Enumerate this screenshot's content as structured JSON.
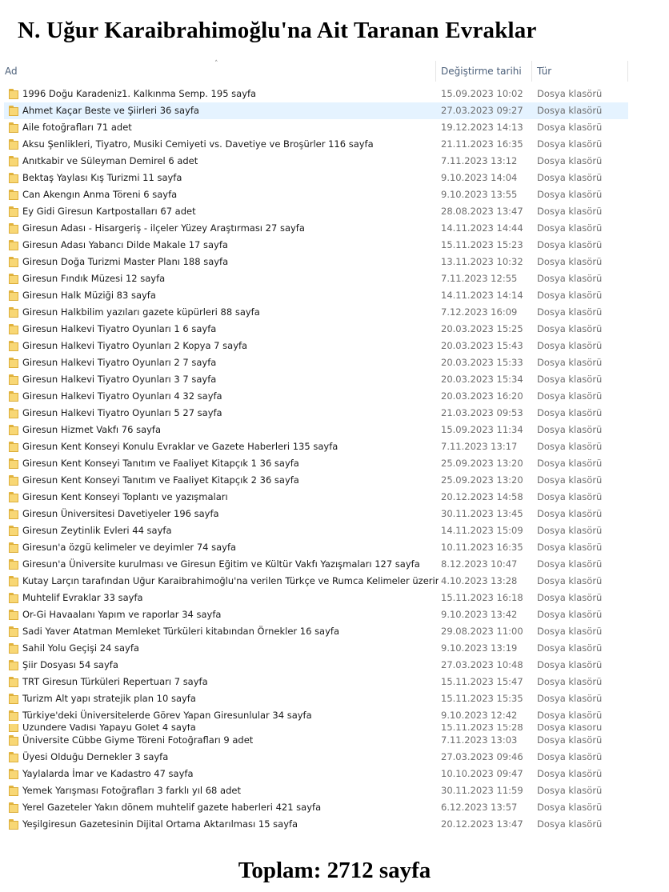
{
  "title": "N. Uğur Karaibrahimoğlu'na Ait Taranan Evraklar",
  "columns": {
    "name": "Ad",
    "date": "Değiştirme tarihi",
    "type": "Tür"
  },
  "rows": [
    {
      "name": "1996 Doğu Karadeniz1. Kalkınma Semp. 195 sayfa",
      "date": "15.09.2023 10:02",
      "type": "Dosya klasörü"
    },
    {
      "name": "Ahmet Kaçar Beste ve Şiirleri 36 sayfa",
      "date": "27.03.2023 09:27",
      "type": "Dosya klasörü",
      "selected": true
    },
    {
      "name": "Aile fotoğrafları 71 adet",
      "date": "19.12.2023 14:13",
      "type": "Dosya klasörü"
    },
    {
      "name": "Aksu Şenlikleri, Tiyatro, Musiki Cemiyeti vs. Davetiye ve Broşürler 116 sayfa",
      "date": "21.11.2023 16:35",
      "type": "Dosya klasörü"
    },
    {
      "name": "Anıtkabir ve Süleyman Demirel 6 adet",
      "date": "7.11.2023 13:12",
      "type": "Dosya klasörü"
    },
    {
      "name": "Bektaş Yaylası Kış Turizmi 11 sayfa",
      "date": "9.10.2023 14:04",
      "type": "Dosya klasörü"
    },
    {
      "name": "Can Akengın Anma Töreni 6 sayfa",
      "date": "9.10.2023 13:55",
      "type": "Dosya klasörü"
    },
    {
      "name": "Ey Gidi Giresun Kartpostalları 67 adet",
      "date": "28.08.2023 13:47",
      "type": "Dosya klasörü"
    },
    {
      "name": "Giresun Adası - Hisargeriş - ilçeler Yüzey Araştırması 27 sayfa",
      "date": "14.11.2023 14:44",
      "type": "Dosya klasörü"
    },
    {
      "name": "Giresun Adası Yabancı Dilde Makale 17 sayfa",
      "date": "15.11.2023 15:23",
      "type": "Dosya klasörü"
    },
    {
      "name": "Giresun Doğa Turizmi Master Planı 188 sayfa",
      "date": "13.11.2023 10:32",
      "type": "Dosya klasörü"
    },
    {
      "name": "Giresun Fındık Müzesi 12 sayfa",
      "date": "7.11.2023 12:55",
      "type": "Dosya klasörü"
    },
    {
      "name": "Giresun Halk Müziği 83 sayfa",
      "date": "14.11.2023 14:14",
      "type": "Dosya klasörü"
    },
    {
      "name": "Giresun Halkbilim yazıları gazete küpürleri 88 sayfa",
      "date": "7.12.2023 16:09",
      "type": "Dosya klasörü"
    },
    {
      "name": "Giresun Halkevi Tiyatro Oyunları 1 6 sayfa",
      "date": "20.03.2023 15:25",
      "type": "Dosya klasörü"
    },
    {
      "name": "Giresun Halkevi Tiyatro Oyunları 2  Kopya 7 sayfa",
      "date": "20.03.2023 15:43",
      "type": "Dosya klasörü"
    },
    {
      "name": "Giresun Halkevi Tiyatro Oyunları 2 7 sayfa",
      "date": "20.03.2023 15:33",
      "type": "Dosya klasörü"
    },
    {
      "name": "Giresun Halkevi Tiyatro Oyunları 3 7 sayfa",
      "date": "20.03.2023 15:34",
      "type": "Dosya klasörü"
    },
    {
      "name": "Giresun Halkevi Tiyatro Oyunları 4 32 sayfa",
      "date": "20.03.2023 16:20",
      "type": "Dosya klasörü"
    },
    {
      "name": "Giresun Halkevi Tiyatro Oyunları 5 27 sayfa",
      "date": "21.03.2023 09:53",
      "type": "Dosya klasörü"
    },
    {
      "name": "Giresun Hizmet Vakfı 76 sayfa",
      "date": "15.09.2023 11:34",
      "type": "Dosya klasörü"
    },
    {
      "name": "Giresun Kent Konseyi Konulu Evraklar ve Gazete Haberleri 135 sayfa",
      "date": "7.11.2023 13:17",
      "type": "Dosya klasörü"
    },
    {
      "name": "Giresun Kent Konseyi Tanıtım ve Faaliyet Kitapçık 1 36 sayfa",
      "date": "25.09.2023 13:20",
      "type": "Dosya klasörü"
    },
    {
      "name": "Giresun Kent Konseyi Tanıtım ve Faaliyet Kitapçık 2 36 sayfa",
      "date": "25.09.2023 13:20",
      "type": "Dosya klasörü"
    },
    {
      "name": "Giresun Kent Konseyi Toplantı ve yazışmaları",
      "date": "20.12.2023 14:58",
      "type": "Dosya klasörü"
    },
    {
      "name": "Giresun Üniversitesi Davetiyeler 196 sayfa",
      "date": "30.11.2023 13:45",
      "type": "Dosya klasörü"
    },
    {
      "name": "Giresun Zeytinlik Evleri 44 sayfa",
      "date": "14.11.2023 15:09",
      "type": "Dosya klasörü"
    },
    {
      "name": "Giresun'a özgü kelimeler ve deyimler 74 sayfa",
      "date": "10.11.2023 16:35",
      "type": "Dosya klasörü"
    },
    {
      "name": "Giresun'a Üniversite kurulması ve Giresun Eğitim ve Kültür Vakfı Yazışmaları 127 sayfa",
      "date": "8.12.2023 10:47",
      "type": "Dosya klasörü"
    },
    {
      "name": "Kutay Larçın tarafından Uğur Karaibrahimoğlu'na verilen Türkçe ve Rumca Kelimeler üzerine Ça...",
      "date": "4.10.2023 13:28",
      "type": "Dosya klasörü"
    },
    {
      "name": "Muhtelif Evraklar 33 sayfa",
      "date": "15.11.2023 16:18",
      "type": "Dosya klasörü"
    },
    {
      "name": "Or-Gi Havaalanı Yapım ve raporlar 34 sayfa",
      "date": "9.10.2023 13:42",
      "type": "Dosya klasörü"
    },
    {
      "name": "Sadi Yaver Atatman Memleket Türküleri kitabından Örnekler 16 sayfa",
      "date": "29.08.2023 11:00",
      "type": "Dosya klasörü"
    },
    {
      "name": "Sahil Yolu Geçişi 24 sayfa",
      "date": "9.10.2023 13:19",
      "type": "Dosya klasörü"
    },
    {
      "name": "Şiir Dosyası 54 sayfa",
      "date": "27.03.2023 10:48",
      "type": "Dosya klasörü"
    },
    {
      "name": "TRT Giresun Türküleri Repertuarı 7 sayfa",
      "date": "15.11.2023 15:47",
      "type": "Dosya klasörü"
    },
    {
      "name": "Turizm Alt yapı stratejik plan 10 sayfa",
      "date": "15.11.2023 15:35",
      "type": "Dosya klasörü"
    },
    {
      "name": "Türkiye'deki Üniversitelerde Görev Yapan Giresunlular 34 sayfa",
      "date": "9.10.2023 12:42",
      "type": "Dosya klasörü"
    },
    {
      "name": "Üzündere Vadisi Yapayu Gölet 4 sayfa",
      "date": "15.11.2023 15:28",
      "type": "Dosya klasörü",
      "partial": true
    },
    {
      "name": "Üniversite Cübbe Giyme Töreni Fotoğrafları 9 adet",
      "date": "7.11.2023 13:03",
      "type": "Dosya klasörü"
    },
    {
      "name": "Üyesi Olduğu Dernekler 3 sayfa",
      "date": "27.03.2023 09:46",
      "type": "Dosya klasörü"
    },
    {
      "name": "Yaylalarda İmar ve Kadastro 47 sayfa",
      "date": "10.10.2023 09:47",
      "type": "Dosya klasörü"
    },
    {
      "name": "Yemek Yarışması Fotoğrafları 3 farklı yıl 68 adet",
      "date": "30.11.2023 11:59",
      "type": "Dosya klasörü"
    },
    {
      "name": "Yerel Gazeteler Yakın dönem muhtelif gazete haberleri 421 sayfa",
      "date": "6.12.2023 13:57",
      "type": "Dosya klasörü"
    },
    {
      "name": "Yeşilgiresun Gazetesinin Dijital Ortama Aktarılması 15 sayfa",
      "date": "20.12.2023 13:47",
      "type": "Dosya klasörü"
    }
  ],
  "total": "Toplam: 2712 sayfa"
}
